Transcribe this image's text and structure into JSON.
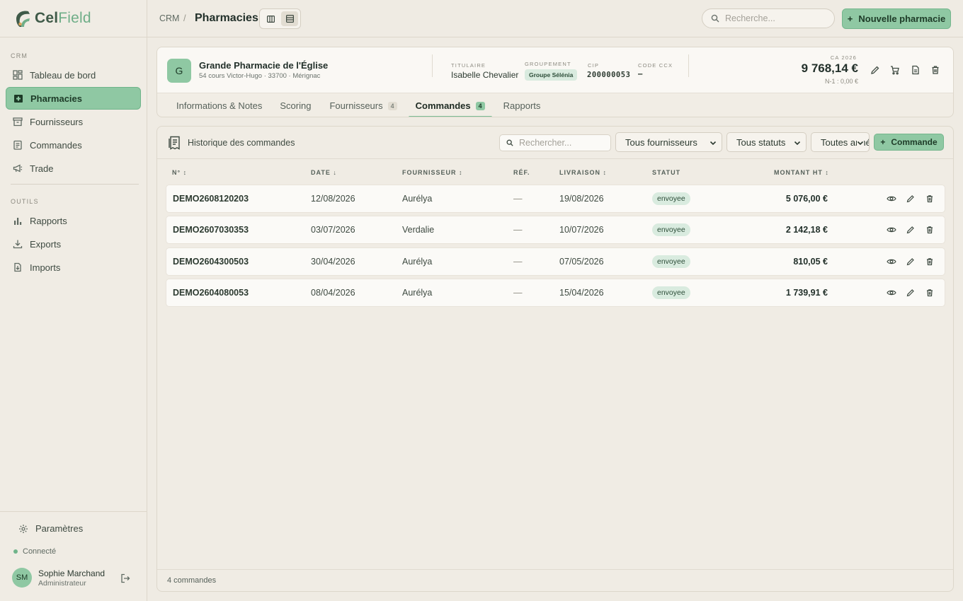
{
  "brand": {
    "name_bold": "Cel",
    "name_light": "Field",
    "icon": "celfield-logo-icon"
  },
  "sidebar": {
    "section_crm": "CRM",
    "section_tools": "OUTILS",
    "crm_items": [
      {
        "label": "Tableau de bord",
        "icon": "dashboard-icon"
      },
      {
        "label": "Pharmacies",
        "icon": "pharmacy-icon",
        "active": true
      },
      {
        "label": "Fournisseurs",
        "icon": "archive-icon"
      },
      {
        "label": "Commandes",
        "icon": "clipboard-icon"
      },
      {
        "label": "Trade",
        "icon": "megaphone-icon"
      }
    ],
    "tool_items": [
      {
        "label": "Rapports",
        "icon": "bar-chart-icon"
      },
      {
        "label": "Exports",
        "icon": "download-icon"
      },
      {
        "label": "Imports",
        "icon": "file-import-icon"
      }
    ],
    "settings_label": "Paramètres",
    "status_label": "Connecté",
    "user": {
      "initials": "SM",
      "name": "Sophie Marchand",
      "role": "Administrateur"
    }
  },
  "topbar": {
    "breadcrumb_root": "CRM",
    "breadcrumb_sep": "/",
    "page_title": "Pharmacies",
    "search_placeholder": "Recherche...",
    "new_button": "Nouvelle pharmacie"
  },
  "pharmacy": {
    "initial": "G",
    "name": "Grande Pharmacie de l'Église",
    "address": "54 cours Victor-Hugo · 33700 · Mérignac",
    "titulaire_label": "TITULAIRE",
    "titulaire": "Isabelle Chevalier",
    "groupement_label": "GROUPEMENT",
    "groupement": "Groupe Sélénia",
    "cip_label": "CIP",
    "cip": "200000053",
    "ccx_label": "CODE CCX",
    "ccx": "–",
    "ca_label": "CA 2026",
    "ca_value": "9 768,14 €",
    "ca_prev": "N-1 : 0,00 €"
  },
  "tabs": [
    {
      "label": "Informations & Notes"
    },
    {
      "label": "Scoring"
    },
    {
      "label": "Fournisseurs",
      "count": "4"
    },
    {
      "label": "Commandes",
      "count": "4",
      "active": true
    },
    {
      "label": "Rapports"
    }
  ],
  "orders": {
    "title": "Historique des commandes",
    "search_placeholder": "Rechercher...",
    "filter_supplier": "Tous fournisseurs",
    "filter_status": "Tous statuts",
    "filter_year": "Toutes années",
    "add_button": "Commande",
    "columns": {
      "number": "N° ↕",
      "date": "DATE ↓",
      "supplier": "FOURNISSEUR ↕",
      "ref": "RÉF.",
      "delivery": "LIVRAISON ↕",
      "status": "STATUT",
      "amount": "MONTANT HT ↕"
    },
    "rows": [
      {
        "number": "DEMO2608120203",
        "date": "12/08/2026",
        "supplier": "Aurélya",
        "ref": "—",
        "delivery": "19/08/2026",
        "status": "envoyee",
        "amount": "5 076,00 €"
      },
      {
        "number": "DEMO2607030353",
        "date": "03/07/2026",
        "supplier": "Verdalie",
        "ref": "—",
        "delivery": "10/07/2026",
        "status": "envoyee",
        "amount": "2 142,18 €"
      },
      {
        "number": "DEMO2604300503",
        "date": "30/04/2026",
        "supplier": "Aurélya",
        "ref": "—",
        "delivery": "07/05/2026",
        "status": "envoyee",
        "amount": "810,05 €"
      },
      {
        "number": "DEMO2604080053",
        "date": "08/04/2026",
        "supplier": "Aurélya",
        "ref": "—",
        "delivery": "15/04/2026",
        "status": "envoyee",
        "amount": "1 739,91 €"
      }
    ],
    "footer_count": "4 commandes"
  },
  "colors": {
    "accent": "#8fc8a3",
    "accent_border": "#6fb48a",
    "background": "#efebe3",
    "text": "#2c3a30"
  }
}
